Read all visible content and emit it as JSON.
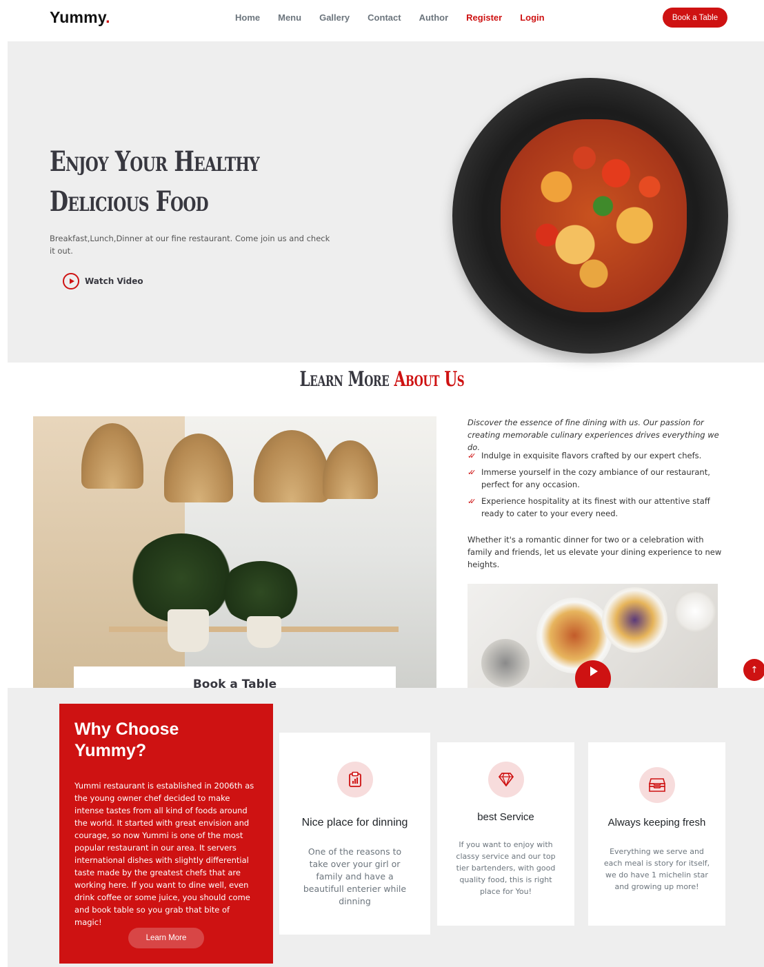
{
  "header": {
    "logo_text": "Yummy",
    "logo_dot": ".",
    "nav": [
      {
        "label": "Home"
      },
      {
        "label": "Menu"
      },
      {
        "label": "Gallery"
      },
      {
        "label": "Contact"
      },
      {
        "label": "Author"
      },
      {
        "label": "Register"
      },
      {
        "label": "Login"
      }
    ],
    "cta_label": "Book a Table"
  },
  "hero": {
    "title_line1": "Enjoy Your Healthy",
    "title_line2": "Delicious Food",
    "text": "Breakfast,Lunch,Dinner at our fine restaurant. Come join us and check it out.",
    "watch_label": "Watch Video"
  },
  "about": {
    "title_prefix": "Learn More",
    "title_highlight": "About Us",
    "book_label": "Book a Table",
    "lead": "Discover the essence of fine dining with us. Our passion for creating memorable culinary experiences drives everything we do.",
    "checklist": [
      {
        "text": "Indulge in exquisite flavors crafted by our expert chefs."
      },
      {
        "text": "Immerse yourself in the cozy ambiance of our restaurant, perfect for any occasion."
      },
      {
        "text": "Experience hospitality at its finest with our attentive staff ready to cater to your every need."
      }
    ],
    "paragraph": "Whether it's a romantic dinner for two or a celebration with family and friends, let us elevate your dining experience to new heights."
  },
  "why": {
    "title": "Why Choose Yummy?",
    "text": "Yummi restaurant is established in 2006th as the young owner chef decided to make intense tastes from all kind of foods around the world. It started with great envision and courage, so now Yummi is one of the most popular restaurant in our area. It servers international dishes with slightly differential taste made by the greatest chefs that are working here. If you want to dine well, even drink coffee or some juice, you should come and book table so you grab that bite of magic!",
    "button_label": "Learn More",
    "cards": [
      {
        "title": "Nice place for dinning",
        "text": "One of the reasons to take over your girl or family and have a beautifull enterier while dinning",
        "icon": "clipboard-data-icon"
      },
      {
        "title": "best Service",
        "text": "If you want to enjoy with classy service and our top tier bartenders, with good quality food, this is right place for You!",
        "icon": "gem-icon"
      },
      {
        "title": "Always keeping fresh",
        "text": "Everything we serve and each meal is story for itself, we do have 1 michelin star and growing up more!",
        "icon": "inboxes-icon"
      }
    ]
  },
  "colors": {
    "accent": "#ce1212",
    "background_light": "#eeeeee",
    "heading": "#37373f"
  }
}
